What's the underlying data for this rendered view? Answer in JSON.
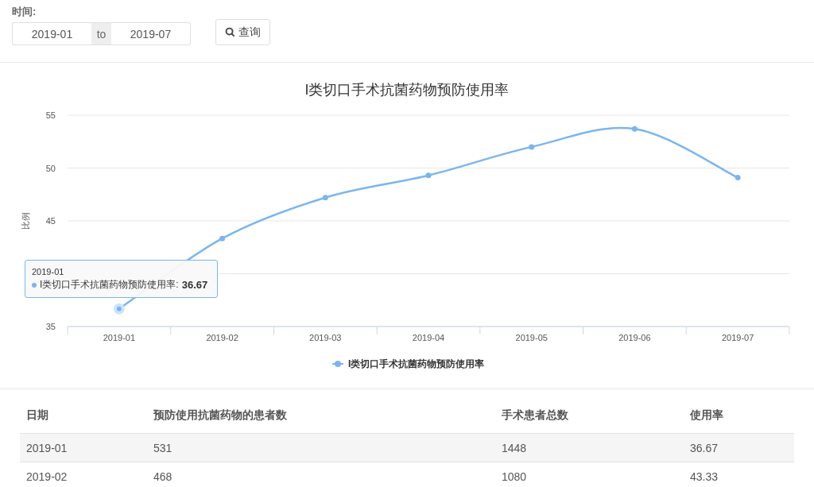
{
  "filter": {
    "label": "时间:",
    "start": "2019-01",
    "separator": "to",
    "end": "2019-07",
    "button": "查询"
  },
  "chart": {
    "chart_data": {
      "type": "line",
      "title": "I类切口手术抗菌药物预防使用率",
      "ylabel": "比例",
      "categories": [
        "2019-01",
        "2019-02",
        "2019-03",
        "2019-04",
        "2019-05",
        "2019-06",
        "2019-07"
      ],
      "series": [
        {
          "name": "I类切口手术抗菌药物预防使用率",
          "color": "#7cb5ec",
          "marker": "circle",
          "values": [
            36.67,
            43.33,
            47.2,
            49.3,
            52.0,
            53.7,
            49.1
          ]
        }
      ],
      "ylim": [
        35,
        55
      ],
      "yticks": [
        35,
        45,
        50,
        55
      ]
    },
    "tooltip": {
      "title": "2019-01",
      "label": "I类切口手术抗菌药物预防使用率:",
      "value": "36.67"
    }
  },
  "table": {
    "columns": [
      "日期",
      "预防使用抗菌药物的患者数",
      "手术患者总数",
      "使用率"
    ],
    "rows": [
      [
        "2019-01",
        "531",
        "1448",
        "36.67"
      ],
      [
        "2019-02",
        "468",
        "1080",
        "43.33"
      ]
    ]
  }
}
